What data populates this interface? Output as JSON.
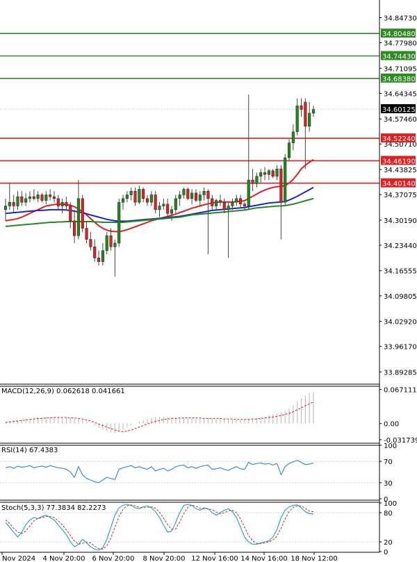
{
  "chart_data": [
    {
      "type": "candlestick",
      "panel": "price",
      "ylim": [
        33.86,
        34.88
      ],
      "y_ticks": [
        "34.84730",
        "34.77980",
        "34.71095",
        "34.64345",
        "34.57460",
        "34.50710",
        "34.43825",
        "34.37075",
        "34.30190",
        "34.23440",
        "34.16555",
        "34.09805",
        "34.02920",
        "33.96170",
        "33.89285"
      ],
      "x_ticks": [
        "Nov 2024",
        "4 Nov 20:00",
        "6 Nov 20:00",
        "8 Nov 20:00",
        "12 Nov 16:00",
        "14 Nov 16:00",
        "18 Nov 12:00"
      ],
      "current_price": {
        "label": "34.60125",
        "value": 34.60125
      },
      "grid": false,
      "levels": [
        {
          "label": "34.80480",
          "value": 34.8048,
          "color": "#2e8b22"
        },
        {
          "label": "34.74430",
          "value": 34.7443,
          "color": "#2e8b22"
        },
        {
          "label": "34.68380",
          "value": 34.6838,
          "color": "#2e8b22"
        },
        {
          "label": "34.52240",
          "value": 34.5224,
          "color": "#e02020"
        },
        {
          "label": "34.46190",
          "value": 34.4619,
          "color": "#e02020"
        },
        {
          "label": "34.40140",
          "value": 34.4014,
          "color": "#e02020"
        }
      ],
      "candles": [
        [
          34.33,
          34.36,
          34.3,
          34.34
        ],
        [
          34.34,
          34.4,
          34.33,
          34.35
        ],
        [
          34.35,
          34.37,
          34.32,
          34.34
        ],
        [
          34.34,
          34.38,
          34.33,
          34.365
        ],
        [
          34.365,
          34.38,
          34.34,
          34.35
        ],
        [
          34.35,
          34.375,
          34.34,
          34.36
        ],
        [
          34.36,
          34.38,
          34.35,
          34.365
        ],
        [
          34.365,
          34.385,
          34.355,
          34.36
        ],
        [
          34.36,
          34.38,
          34.35,
          34.37
        ],
        [
          34.37,
          34.375,
          34.35,
          34.355
        ],
        [
          34.355,
          34.38,
          34.345,
          34.37
        ],
        [
          34.37,
          34.385,
          34.355,
          34.365
        ],
        [
          34.365,
          34.38,
          34.35,
          34.36
        ],
        [
          34.36,
          34.37,
          34.33,
          34.34
        ],
        [
          34.34,
          34.36,
          34.32,
          34.35
        ],
        [
          34.35,
          34.365,
          34.33,
          34.34
        ],
        [
          34.34,
          34.35,
          34.28,
          34.3
        ],
        [
          34.3,
          34.33,
          34.24,
          34.26
        ],
        [
          34.26,
          34.41,
          34.25,
          34.36
        ],
        [
          34.36,
          34.37,
          34.27,
          34.28
        ],
        [
          34.28,
          34.3,
          34.24,
          34.25
        ],
        [
          34.25,
          34.27,
          34.22,
          34.23
        ],
        [
          34.23,
          34.25,
          34.19,
          34.2
        ],
        [
          34.2,
          34.22,
          34.18,
          34.19
        ],
        [
          34.19,
          34.24,
          34.18,
          34.22
        ],
        [
          34.22,
          34.27,
          34.21,
          34.26
        ],
        [
          34.26,
          34.28,
          34.22,
          34.23
        ],
        [
          34.23,
          34.25,
          34.15,
          34.24
        ],
        [
          34.24,
          34.36,
          34.23,
          34.35
        ],
        [
          34.35,
          34.37,
          34.33,
          34.36
        ],
        [
          34.36,
          34.38,
          34.35,
          34.37
        ],
        [
          34.37,
          34.39,
          34.355,
          34.38
        ],
        [
          34.38,
          34.39,
          34.34,
          34.35
        ],
        [
          34.35,
          34.395,
          34.345,
          34.385
        ],
        [
          34.385,
          34.39,
          34.35,
          34.36
        ],
        [
          34.36,
          34.37,
          34.34,
          34.35
        ],
        [
          34.35,
          34.38,
          34.34,
          34.37
        ],
        [
          34.37,
          34.38,
          34.32,
          34.33
        ],
        [
          34.33,
          34.35,
          34.31,
          34.34
        ],
        [
          34.34,
          34.36,
          34.33,
          34.345
        ],
        [
          34.345,
          34.36,
          34.31,
          34.32
        ],
        [
          34.32,
          34.34,
          34.3,
          34.33
        ],
        [
          34.33,
          34.37,
          34.32,
          34.36
        ],
        [
          34.36,
          34.38,
          34.34,
          34.37
        ],
        [
          34.37,
          34.39,
          34.36,
          34.385
        ],
        [
          34.385,
          34.39,
          34.355,
          34.36
        ],
        [
          34.36,
          34.385,
          34.345,
          34.375
        ],
        [
          34.375,
          34.385,
          34.35,
          34.355
        ],
        [
          34.355,
          34.38,
          34.34,
          34.37
        ],
        [
          34.37,
          34.39,
          34.355,
          34.38
        ],
        [
          34.38,
          34.385,
          34.21,
          34.36
        ],
        [
          34.36,
          34.37,
          34.33,
          34.34
        ],
        [
          34.34,
          34.36,
          34.33,
          34.355
        ],
        [
          34.355,
          34.37,
          34.34,
          34.35
        ],
        [
          34.35,
          34.36,
          34.32,
          34.33
        ],
        [
          34.33,
          34.35,
          34.2,
          34.34
        ],
        [
          34.34,
          34.36,
          34.33,
          34.35
        ],
        [
          34.35,
          34.37,
          34.34,
          34.36
        ],
        [
          34.36,
          34.37,
          34.335,
          34.345
        ],
        [
          34.345,
          34.35,
          34.33,
          34.34
        ],
        [
          34.34,
          34.64,
          34.33,
          34.41
        ],
        [
          34.41,
          34.44,
          34.38,
          34.4
        ],
        [
          34.4,
          34.43,
          34.39,
          34.42
        ],
        [
          34.42,
          34.44,
          34.4,
          34.43
        ],
        [
          34.43,
          34.445,
          34.41,
          34.425
        ],
        [
          34.425,
          34.44,
          34.41,
          34.435
        ],
        [
          34.435,
          34.44,
          34.415,
          34.42
        ],
        [
          34.42,
          34.45,
          34.41,
          34.44
        ],
        [
          34.44,
          34.45,
          34.25,
          34.35
        ],
        [
          34.35,
          34.48,
          34.34,
          34.47
        ],
        [
          34.47,
          34.52,
          34.46,
          34.51
        ],
        [
          34.51,
          34.56,
          34.49,
          34.54
        ],
        [
          34.54,
          34.63,
          34.53,
          34.61
        ],
        [
          34.61,
          34.63,
          34.58,
          34.6
        ],
        [
          34.62,
          34.63,
          34.44,
          34.555
        ],
        [
          34.555,
          34.62,
          34.54,
          34.59
        ],
        [
          34.59,
          34.61,
          34.58,
          34.6
        ]
      ],
      "series": [
        {
          "name": "ma_fast",
          "color": "#e02020",
          "values": [
            34.3,
            34.302,
            34.304,
            34.306,
            34.31,
            34.315,
            34.32,
            34.325,
            34.33,
            34.335,
            34.34,
            34.342,
            34.344,
            34.345,
            34.345,
            34.344,
            34.342,
            34.338,
            34.332,
            34.325,
            34.316,
            34.306,
            34.296,
            34.287,
            34.28,
            34.275,
            34.272,
            34.271,
            34.271,
            34.273,
            34.276,
            34.28,
            34.284,
            34.288,
            34.292,
            34.296,
            34.3,
            34.303,
            34.306,
            34.309,
            34.312,
            34.315,
            34.318,
            34.322,
            34.326,
            34.33,
            34.334,
            34.337,
            34.34,
            34.343,
            34.346,
            34.348,
            34.35,
            34.351,
            34.351,
            34.351,
            34.351,
            34.352,
            34.353,
            34.354,
            34.36,
            34.366,
            34.372,
            34.378,
            34.383,
            34.387,
            34.39,
            34.392,
            34.393,
            34.395,
            34.402,
            34.412,
            34.425,
            34.44,
            34.45,
            34.458,
            34.465
          ]
        },
        {
          "name": "ma_mid",
          "color": "#2020d0",
          "values": [
            34.32,
            34.321,
            34.322,
            34.323,
            34.324,
            34.325,
            34.326,
            34.327,
            34.328,
            34.328,
            34.329,
            34.33,
            34.33,
            34.33,
            34.33,
            34.329,
            34.328,
            34.326,
            34.324,
            34.322,
            34.319,
            34.316,
            34.313,
            34.31,
            34.307,
            34.304,
            34.302,
            34.3,
            34.299,
            34.299,
            34.299,
            34.3,
            34.301,
            34.302,
            34.303,
            34.304,
            34.305,
            34.306,
            34.307,
            34.308,
            34.309,
            34.31,
            34.311,
            34.312,
            34.314,
            34.316,
            34.318,
            34.32,
            34.322,
            34.324,
            34.326,
            34.328,
            34.329,
            34.33,
            34.331,
            34.332,
            34.333,
            34.334,
            34.335,
            34.336,
            34.338,
            34.34,
            34.342,
            34.344,
            34.346,
            34.348,
            34.349,
            34.35,
            34.351,
            34.352,
            34.356,
            34.361,
            34.366,
            34.372,
            34.378,
            34.384,
            34.39
          ]
        },
        {
          "name": "ma_slow",
          "color": "#1e8c1e",
          "values": [
            34.285,
            34.286,
            34.287,
            34.288,
            34.289,
            34.29,
            34.291,
            34.292,
            34.293,
            34.294,
            34.295,
            34.296,
            34.296,
            34.297,
            34.297,
            34.298,
            34.298,
            34.298,
            34.298,
            34.298,
            34.298,
            34.298,
            34.297,
            34.297,
            34.296,
            34.296,
            34.296,
            34.296,
            34.296,
            34.296,
            34.297,
            34.298,
            34.299,
            34.3,
            34.301,
            34.302,
            34.303,
            34.304,
            34.305,
            34.306,
            34.307,
            34.308,
            34.309,
            34.31,
            34.312,
            34.314,
            34.316,
            34.317,
            34.318,
            34.319,
            34.32,
            34.321,
            34.322,
            34.323,
            34.324,
            34.325,
            34.326,
            34.327,
            34.328,
            34.329,
            34.331,
            34.333,
            34.335,
            34.336,
            34.337,
            34.338,
            34.339,
            34.34,
            34.34,
            34.341,
            34.343,
            34.345,
            34.348,
            34.351,
            34.354,
            34.357,
            34.36
          ]
        }
      ]
    },
    {
      "type": "bar",
      "panel": "macd",
      "label": "MACD(12,26,9) 0.062618 0.041661",
      "y_ticks": [
        "0.067111",
        "0.00",
        "-0.031739"
      ],
      "ylim": [
        -0.036,
        0.072
      ],
      "histogram": [
        0.004,
        0.005,
        0.006,
        0.007,
        0.008,
        0.009,
        0.01,
        0.011,
        0.012,
        0.012,
        0.013,
        0.013,
        0.013,
        0.013,
        0.012,
        0.012,
        0.011,
        0.01,
        0.009,
        0.007,
        0.004,
        0.0,
        -0.004,
        -0.008,
        -0.012,
        -0.015,
        -0.017,
        -0.018,
        -0.016,
        -0.012,
        -0.008,
        -0.004,
        0.0,
        0.004,
        0.007,
        0.009,
        0.011,
        0.012,
        0.013,
        0.013,
        0.013,
        0.012,
        0.012,
        0.011,
        0.011,
        0.01,
        0.01,
        0.01,
        0.01,
        0.01,
        0.01,
        0.01,
        0.009,
        0.009,
        0.009,
        0.008,
        0.008,
        0.008,
        0.007,
        0.007,
        0.009,
        0.01,
        0.011,
        0.012,
        0.014,
        0.016,
        0.018,
        0.02,
        0.022,
        0.025,
        0.03,
        0.036,
        0.043,
        0.05,
        0.055,
        0.06,
        0.063
      ],
      "signal": [
        0.002,
        0.003,
        0.004,
        0.005,
        0.006,
        0.007,
        0.008,
        0.009,
        0.01,
        0.01,
        0.011,
        0.011,
        0.012,
        0.012,
        0.012,
        0.012,
        0.011,
        0.011,
        0.01,
        0.009,
        0.007,
        0.005,
        0.002,
        -0.001,
        -0.004,
        -0.007,
        -0.01,
        -0.013,
        -0.015,
        -0.016,
        -0.015,
        -0.013,
        -0.01,
        -0.007,
        -0.004,
        -0.001,
        0.002,
        0.004,
        0.006,
        0.008,
        0.009,
        0.01,
        0.01,
        0.011,
        0.011,
        0.011,
        0.011,
        0.011,
        0.011,
        0.01,
        0.01,
        0.01,
        0.01,
        0.01,
        0.009,
        0.009,
        0.009,
        0.008,
        0.008,
        0.008,
        0.008,
        0.009,
        0.009,
        0.01,
        0.011,
        0.012,
        0.013,
        0.014,
        0.016,
        0.018,
        0.02,
        0.023,
        0.027,
        0.031,
        0.035,
        0.039,
        0.042
      ]
    },
    {
      "type": "line",
      "panel": "rsi",
      "label": "RSI(14) 67.4383",
      "y_ticks": [
        "100",
        "70",
        "30",
        "0"
      ],
      "ylim": [
        0,
        100
      ],
      "values": [
        58,
        60,
        57,
        61,
        59,
        60,
        62,
        58,
        60,
        61,
        59,
        62,
        60,
        58,
        57,
        55,
        50,
        40,
        60,
        45,
        38,
        35,
        32,
        30,
        35,
        40,
        38,
        36,
        55,
        58,
        60,
        62,
        58,
        60,
        57,
        55,
        60,
        52,
        55,
        57,
        52,
        55,
        60,
        62,
        63,
        58,
        60,
        57,
        60,
        62,
        63,
        55,
        56,
        58,
        55,
        53,
        57,
        60,
        56,
        55,
        68,
        64,
        66,
        67,
        65,
        66,
        63,
        66,
        45,
        60,
        66,
        69,
        72,
        68,
        64,
        65,
        67
      ]
    },
    {
      "type": "line",
      "panel": "stoch",
      "label": "Stoch(5,3,3) 77.3834 82.2273",
      "y_ticks": [
        "100",
        "80",
        "20",
        "0"
      ],
      "ylim": [
        0,
        100
      ],
      "k": [
        60,
        50,
        40,
        30,
        40,
        55,
        65,
        70,
        68,
        72,
        75,
        70,
        65,
        55,
        45,
        35,
        20,
        10,
        15,
        25,
        18,
        10,
        5,
        3,
        8,
        25,
        50,
        75,
        90,
        95,
        97,
        95,
        90,
        88,
        92,
        94,
        90,
        82,
        70,
        55,
        40,
        42,
        60,
        80,
        95,
        97,
        95,
        88,
        85,
        90,
        88,
        80,
        75,
        80,
        85,
        88,
        82,
        70,
        50,
        30,
        20,
        15,
        15,
        18,
        20,
        22,
        30,
        45,
        70,
        85,
        92,
        95,
        96,
        90,
        82,
        78,
        77
      ],
      "d": [
        65,
        58,
        48,
        40,
        37,
        42,
        53,
        63,
        68,
        70,
        72,
        72,
        70,
        63,
        55,
        45,
        33,
        22,
        15,
        17,
        19,
        18,
        11,
        6,
        5,
        12,
        28,
        50,
        72,
        87,
        94,
        96,
        94,
        91,
        90,
        91,
        92,
        89,
        81,
        69,
        55,
        46,
        47,
        61,
        78,
        91,
        96,
        93,
        89,
        88,
        88,
        86,
        81,
        78,
        80,
        84,
        85,
        80,
        67,
        50,
        33,
        22,
        17,
        16,
        18,
        20,
        24,
        32,
        48,
        67,
        82,
        91,
        94,
        94,
        89,
        83,
        82
      ]
    }
  ]
}
